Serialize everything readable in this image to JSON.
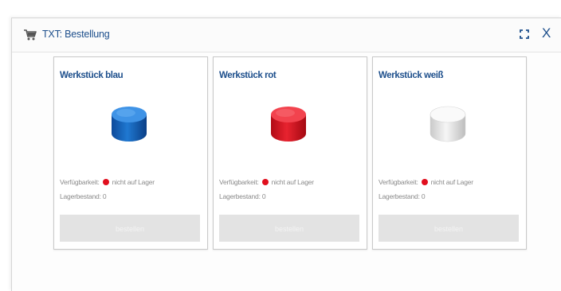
{
  "window": {
    "title": "TXT: Bestellung",
    "icons": {
      "cart": "shopping-cart-icon",
      "maximize": "maximize-icon",
      "close": "close-icon"
    },
    "close_glyph": "X"
  },
  "colors": {
    "accent": "#1d4f8c",
    "status_unavailable": "#e10f1e",
    "button_disabled": "#e3e3e3"
  },
  "products": [
    {
      "title": "Werkstück blau",
      "color": "blue",
      "availability_label": "Verfügbarkeit:",
      "availability_status": "nicht auf Lager",
      "stock_label": "Lagerbestand:",
      "stock_value": "0",
      "button_label": "bestellen"
    },
    {
      "title": "Werkstück rot",
      "color": "red",
      "availability_label": "Verfügbarkeit:",
      "availability_status": "nicht auf Lager",
      "stock_label": "Lagerbestand:",
      "stock_value": "0",
      "button_label": "bestellen"
    },
    {
      "title": "Werkstück weiß",
      "color": "white",
      "availability_label": "Verfügbarkeit:",
      "availability_status": "nicht auf Lager",
      "stock_label": "Lagerbestand:",
      "stock_value": "0",
      "button_label": "bestellen"
    }
  ]
}
